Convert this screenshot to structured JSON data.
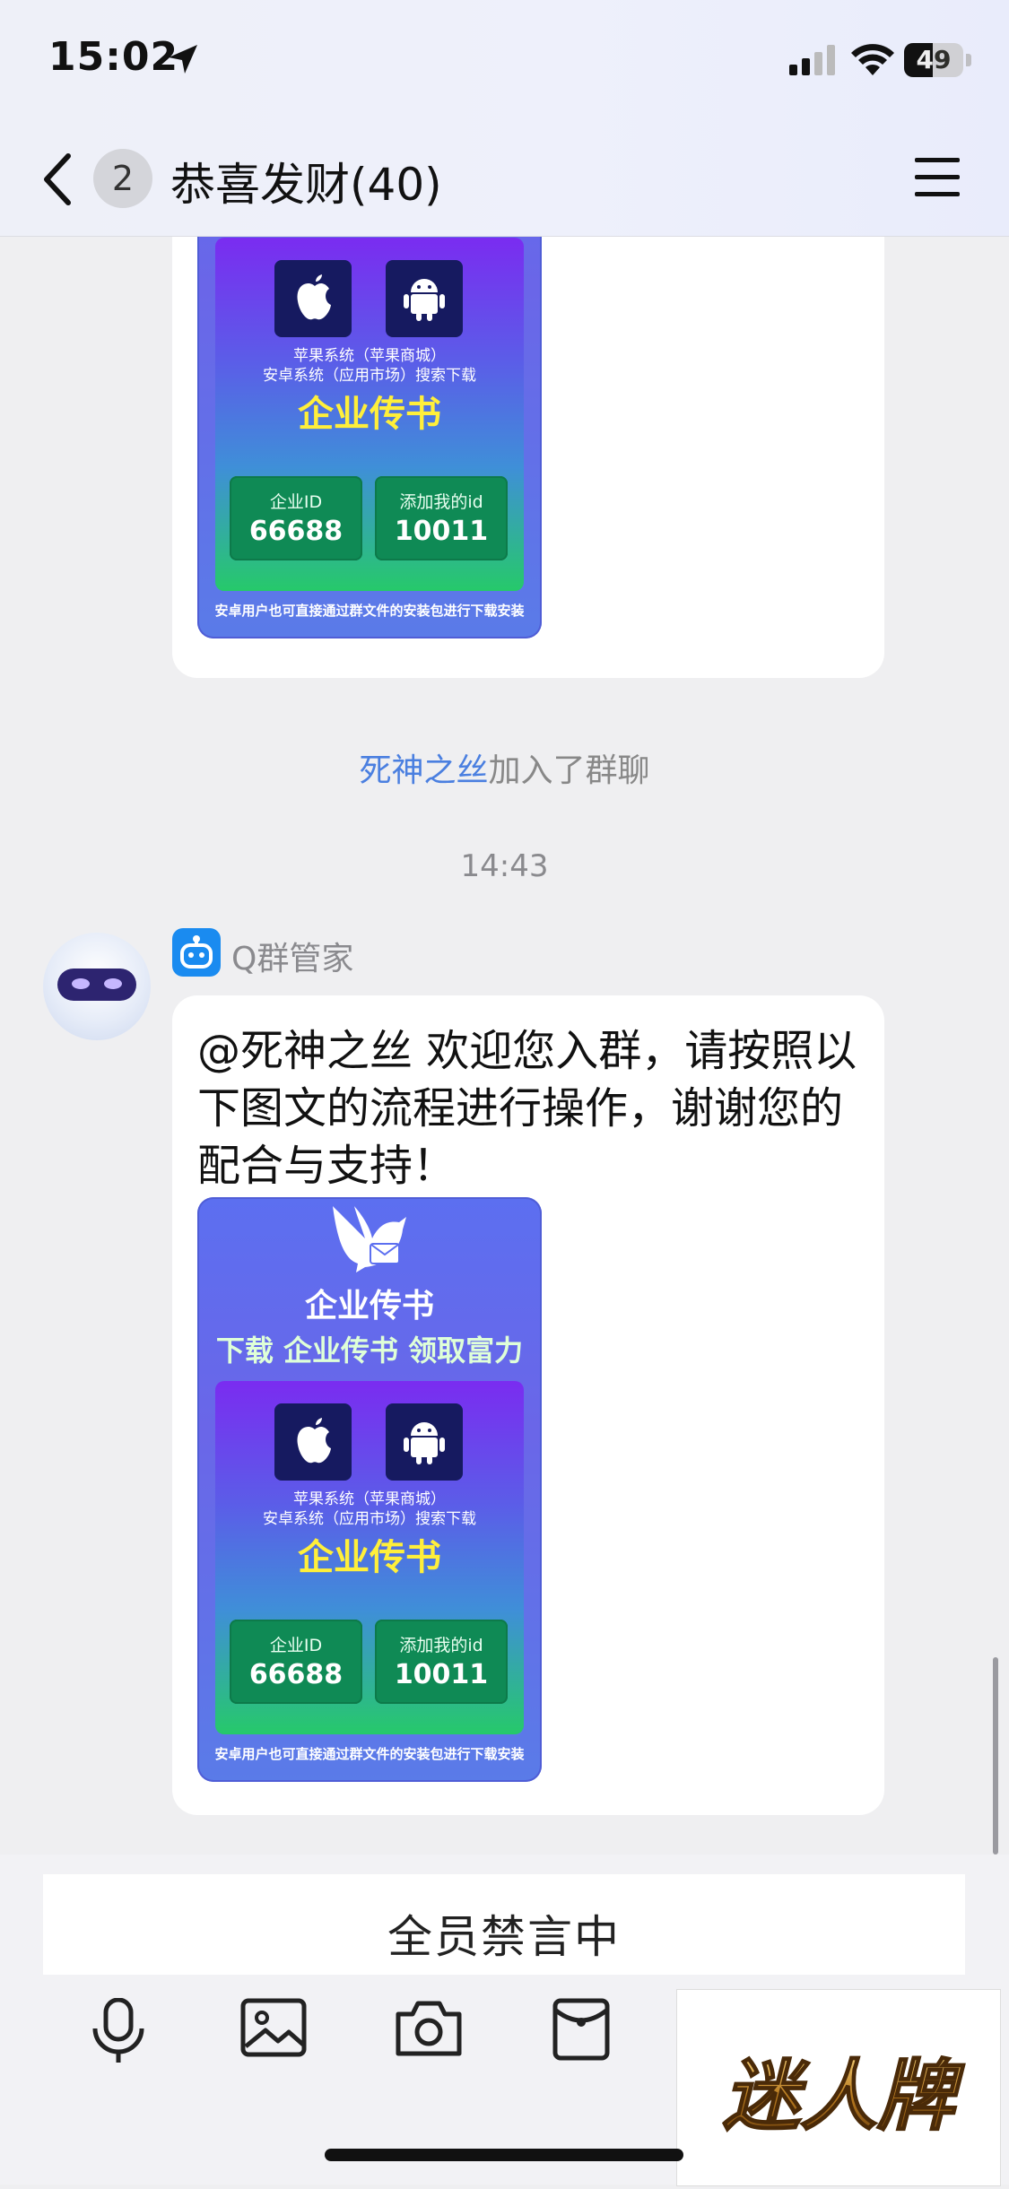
{
  "status_bar": {
    "time": "15:02",
    "battery": "49"
  },
  "nav": {
    "unread_count": "2",
    "title": "恭喜发财(40)"
  },
  "poster": {
    "title": "企业传书",
    "slogan": "下载 企业传书 领取富力",
    "system_line1": "苹果系统（苹果商城）",
    "system_line2": "安卓系统（应用市场）搜索下载",
    "brand": "企业传书",
    "enterprise_id_label": "企业ID",
    "enterprise_id": "66688",
    "my_id_label": "添加我的id",
    "my_id": "10011",
    "footer": "安卓用户也可直接通过群文件的安装包进行下载安装"
  },
  "system_notice": {
    "name": "死神之丝",
    "text": "加入了群聊"
  },
  "timestamp": "14:43",
  "message": {
    "sender": "Q群管家",
    "text": "@死神之丝 欢迎您入群，请按照以下图文的流程进行操作，谢谢您的配合与支持！"
  },
  "input": {
    "muted_text": "全员禁言中"
  },
  "watermark": "迷人牌",
  "icons": [
    "back-icon",
    "location-arrow-icon",
    "signal-icon",
    "wifi-icon",
    "menu-icon",
    "apple-icon",
    "android-icon",
    "dove-icon",
    "robot-icon",
    "microphone-icon",
    "image-icon",
    "camera-icon",
    "red-packet-icon"
  ]
}
